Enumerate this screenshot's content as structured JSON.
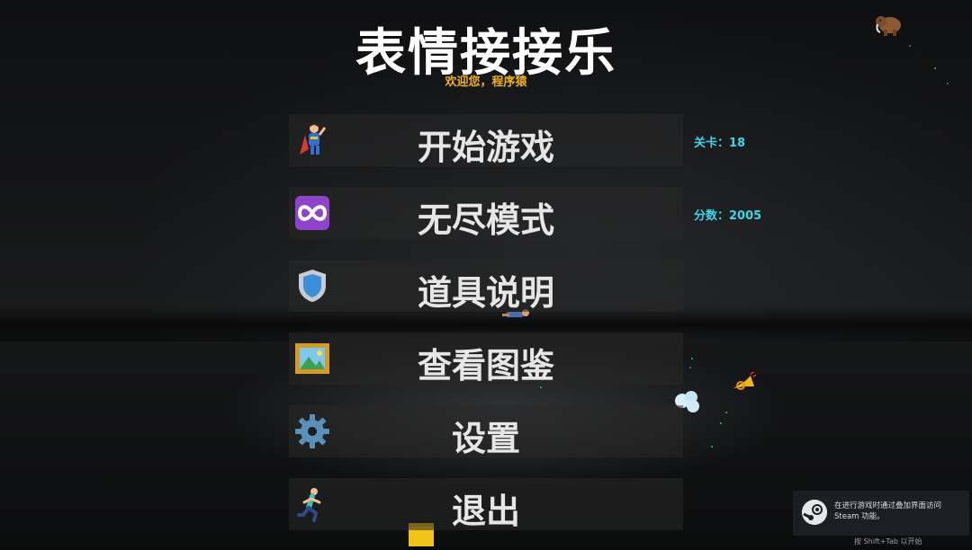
{
  "header": {
    "title": "表情接接乐",
    "subtitle": "欢迎您，程序猿"
  },
  "menu": [
    {
      "label": "开始游戏",
      "icon": "superhero-icon"
    },
    {
      "label": "无尽模式",
      "icon": "infinity-icon"
    },
    {
      "label": "道具说明",
      "icon": "shield-icon"
    },
    {
      "label": "查看图鉴",
      "icon": "framed-picture-icon"
    },
    {
      "label": "设置",
      "icon": "gear-icon"
    },
    {
      "label": "退出",
      "icon": "running-person-icon"
    }
  ],
  "stats": {
    "level": "关卡：18",
    "score": "分数：2005"
  },
  "steam_overlay": {
    "message": "在进行游戏时通过叠加界面访问 Steam 功能。",
    "hint": "按 Shift+Tab 以开始"
  },
  "colors": {
    "title": "#ffffff",
    "subtitle": "#f0b020",
    "stats": "#3fd4e6",
    "button_bg": "rgba(40,40,40,0.55)"
  }
}
